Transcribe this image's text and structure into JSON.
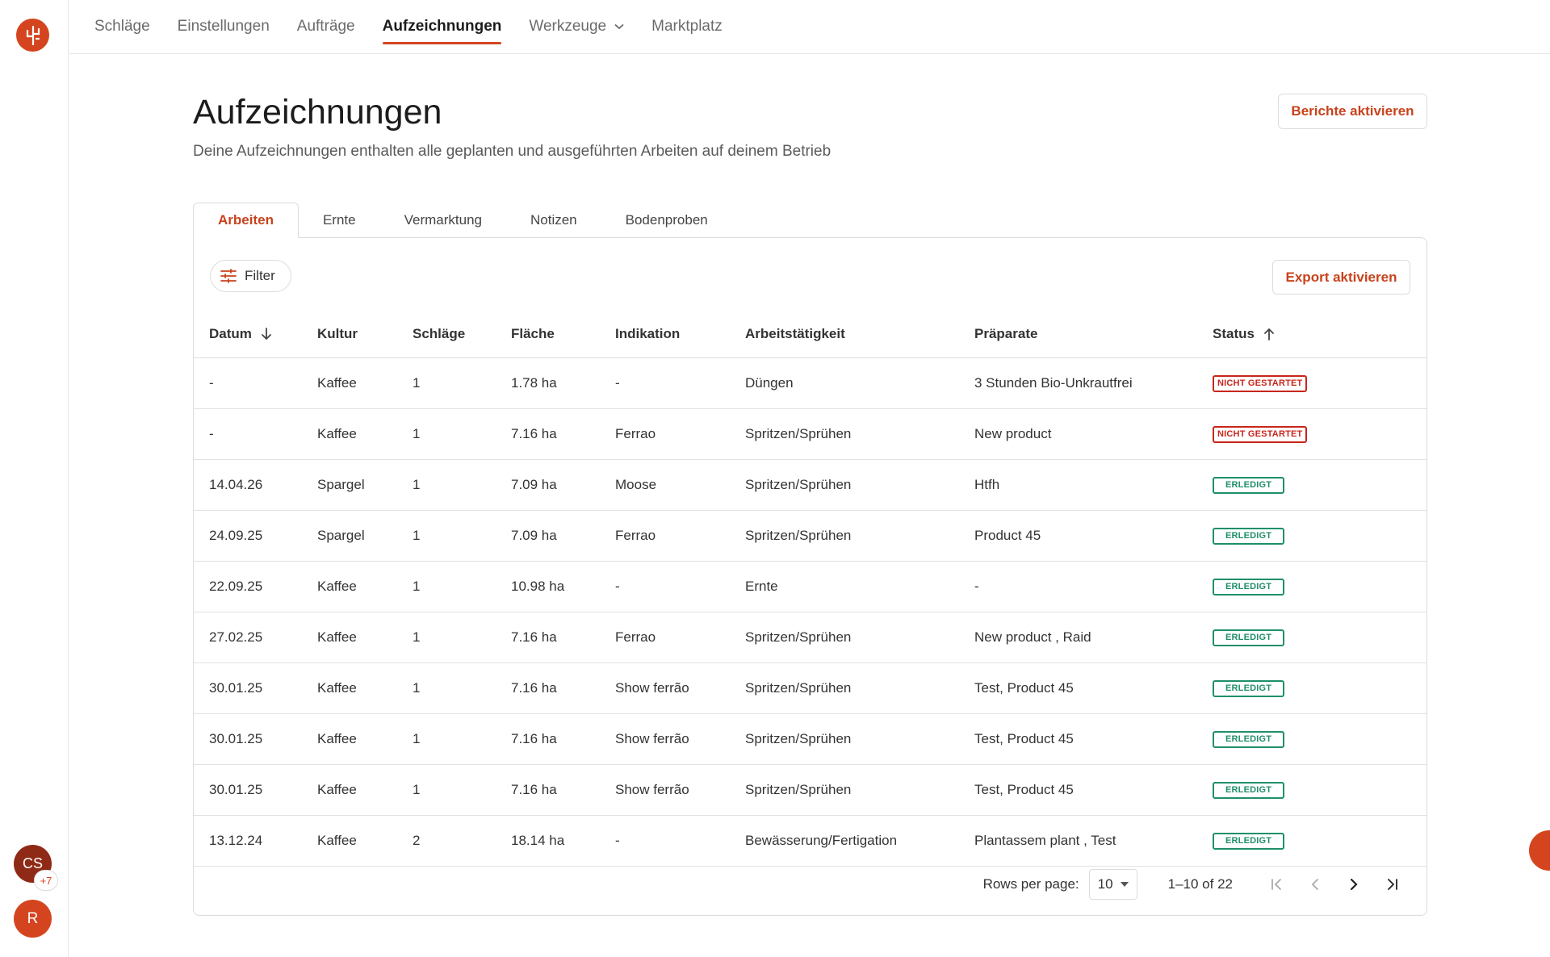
{
  "nav": {
    "items": [
      {
        "label": "Schläge",
        "active": false
      },
      {
        "label": "Einstellungen",
        "active": false
      },
      {
        "label": "Aufträge",
        "active": false
      },
      {
        "label": "Aufzeichnungen",
        "active": true
      },
      {
        "label": "Werkzeuge",
        "active": false,
        "dropdown": true
      },
      {
        "label": "Marktplatz",
        "active": false
      }
    ]
  },
  "page": {
    "title": "Aufzeichnungen",
    "subtitle": "Deine Aufzeichnungen enthalten alle geplanten und ausgeführten Arbeiten auf deinem Betrieb",
    "reports_button": "Berichte aktivieren"
  },
  "tabs": [
    {
      "label": "Arbeiten",
      "active": true
    },
    {
      "label": "Ernte",
      "active": false
    },
    {
      "label": "Vermarktung",
      "active": false
    },
    {
      "label": "Notizen",
      "active": false
    },
    {
      "label": "Bodenproben",
      "active": false
    }
  ],
  "toolbar": {
    "filter_label": "Filter",
    "export_label": "Export aktivieren"
  },
  "table": {
    "columns": [
      "Datum",
      "Kultur",
      "Schläge",
      "Fläche",
      "Indikation",
      "Arbeitstätigkeit",
      "Präparate",
      "Status"
    ],
    "rows": [
      {
        "datum": "-",
        "kultur": "Kaffee",
        "schlaege": "1",
        "flaeche": "1.78 ha",
        "indikation": "-",
        "arbeit": "Düngen",
        "praeparate": "3 Stunden Bio-Unkrautfrei",
        "status": "NICHT GESTARTET",
        "status_type": "open"
      },
      {
        "datum": "-",
        "kultur": "Kaffee",
        "schlaege": "1",
        "flaeche": "7.16 ha",
        "indikation": "Ferrao",
        "arbeit": "Spritzen/Sprühen",
        "praeparate": "New product",
        "status": "NICHT GESTARTET",
        "status_type": "open"
      },
      {
        "datum": "14.04.26",
        "kultur": "Spargel",
        "schlaege": "1",
        "flaeche": "7.09 ha",
        "indikation": "Moose",
        "arbeit": "Spritzen/Sprühen",
        "praeparate": "Htfh",
        "status": "ERLEDIGT",
        "status_type": "done"
      },
      {
        "datum": "24.09.25",
        "kultur": "Spargel",
        "schlaege": "1",
        "flaeche": "7.09 ha",
        "indikation": "Ferrao",
        "arbeit": "Spritzen/Sprühen",
        "praeparate": "Product 45",
        "status": "ERLEDIGT",
        "status_type": "done"
      },
      {
        "datum": "22.09.25",
        "kultur": "Kaffee",
        "schlaege": "1",
        "flaeche": "10.98 ha",
        "indikation": "-",
        "arbeit": "Ernte",
        "praeparate": "-",
        "status": "ERLEDIGT",
        "status_type": "done"
      },
      {
        "datum": "27.02.25",
        "kultur": "Kaffee",
        "schlaege": "1",
        "flaeche": "7.16 ha",
        "indikation": "Ferrao",
        "arbeit": "Spritzen/Sprühen",
        "praeparate": "New product , Raid",
        "status": "ERLEDIGT",
        "status_type": "done"
      },
      {
        "datum": "30.01.25",
        "kultur": "Kaffee",
        "schlaege": "1",
        "flaeche": "7.16 ha",
        "indikation": "Show ferrão",
        "arbeit": "Spritzen/Sprühen",
        "praeparate": "Test, Product 45",
        "status": "ERLEDIGT",
        "status_type": "done"
      },
      {
        "datum": "30.01.25",
        "kultur": "Kaffee",
        "schlaege": "1",
        "flaeche": "7.16 ha",
        "indikation": "Show ferrão",
        "arbeit": "Spritzen/Sprühen",
        "praeparate": "Test, Product 45",
        "status": "ERLEDIGT",
        "status_type": "done"
      },
      {
        "datum": "30.01.25",
        "kultur": "Kaffee",
        "schlaege": "1",
        "flaeche": "7.16 ha",
        "indikation": "Show ferrão",
        "arbeit": "Spritzen/Sprühen",
        "praeparate": "Test, Product 45",
        "status": "ERLEDIGT",
        "status_type": "done"
      },
      {
        "datum": "13.12.24",
        "kultur": "Kaffee",
        "schlaege": "2",
        "flaeche": "18.14 ha",
        "indikation": "-",
        "arbeit": "Bewässerung/Fertigation",
        "praeparate": "Plantassem plant , Test",
        "status": "ERLEDIGT",
        "status_type": "done"
      }
    ]
  },
  "pagination": {
    "rows_per_page_label": "Rows per page:",
    "rows_per_page_value": "10",
    "range_text": "1–10 of 22"
  },
  "avatars": {
    "user_initials": "CS",
    "more_count": "+7",
    "second_initial": "R"
  },
  "colors": {
    "brand": "#d4451f",
    "status_open": "#c8261c",
    "status_done": "#1f8f6b"
  }
}
